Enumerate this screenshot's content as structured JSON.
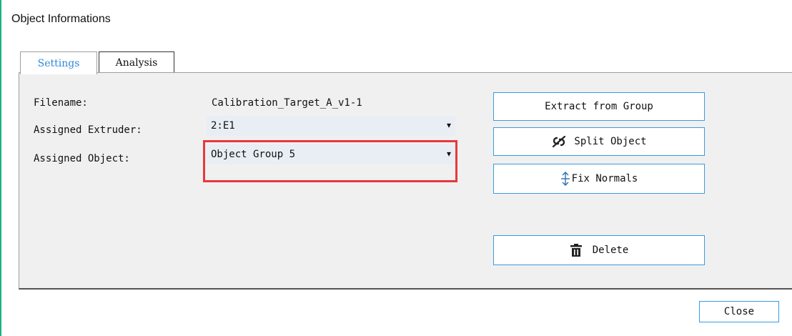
{
  "window": {
    "title": "Object Informations"
  },
  "tabs": [
    {
      "label": "Settings",
      "active": true
    },
    {
      "label": "Analysis",
      "active": false
    }
  ],
  "settings": {
    "filename_label": "Filename:",
    "filename_value": "Calibration_Target_A_v1-1",
    "extruder_label": "Assigned Extruder:",
    "extruder_value": "2:E1",
    "object_label": "Assigned Object:",
    "object_value": "Object Group 5"
  },
  "actions": {
    "extract_label": "Extract from Group",
    "split_label": "Split Object",
    "fix_label": "Fix Normals",
    "delete_label": "Delete"
  },
  "footer": {
    "close_label": "Close"
  },
  "colors": {
    "accent": "#3a9be0",
    "tab_active_text": "#2c8ad8",
    "highlight": "#e8383d",
    "left_accent": "#1bb37a"
  },
  "icons": {
    "split": "unlink-icon",
    "fix": "vertical-arrows-icon",
    "delete": "trash-icon",
    "dropdown": "caret-down-icon"
  }
}
